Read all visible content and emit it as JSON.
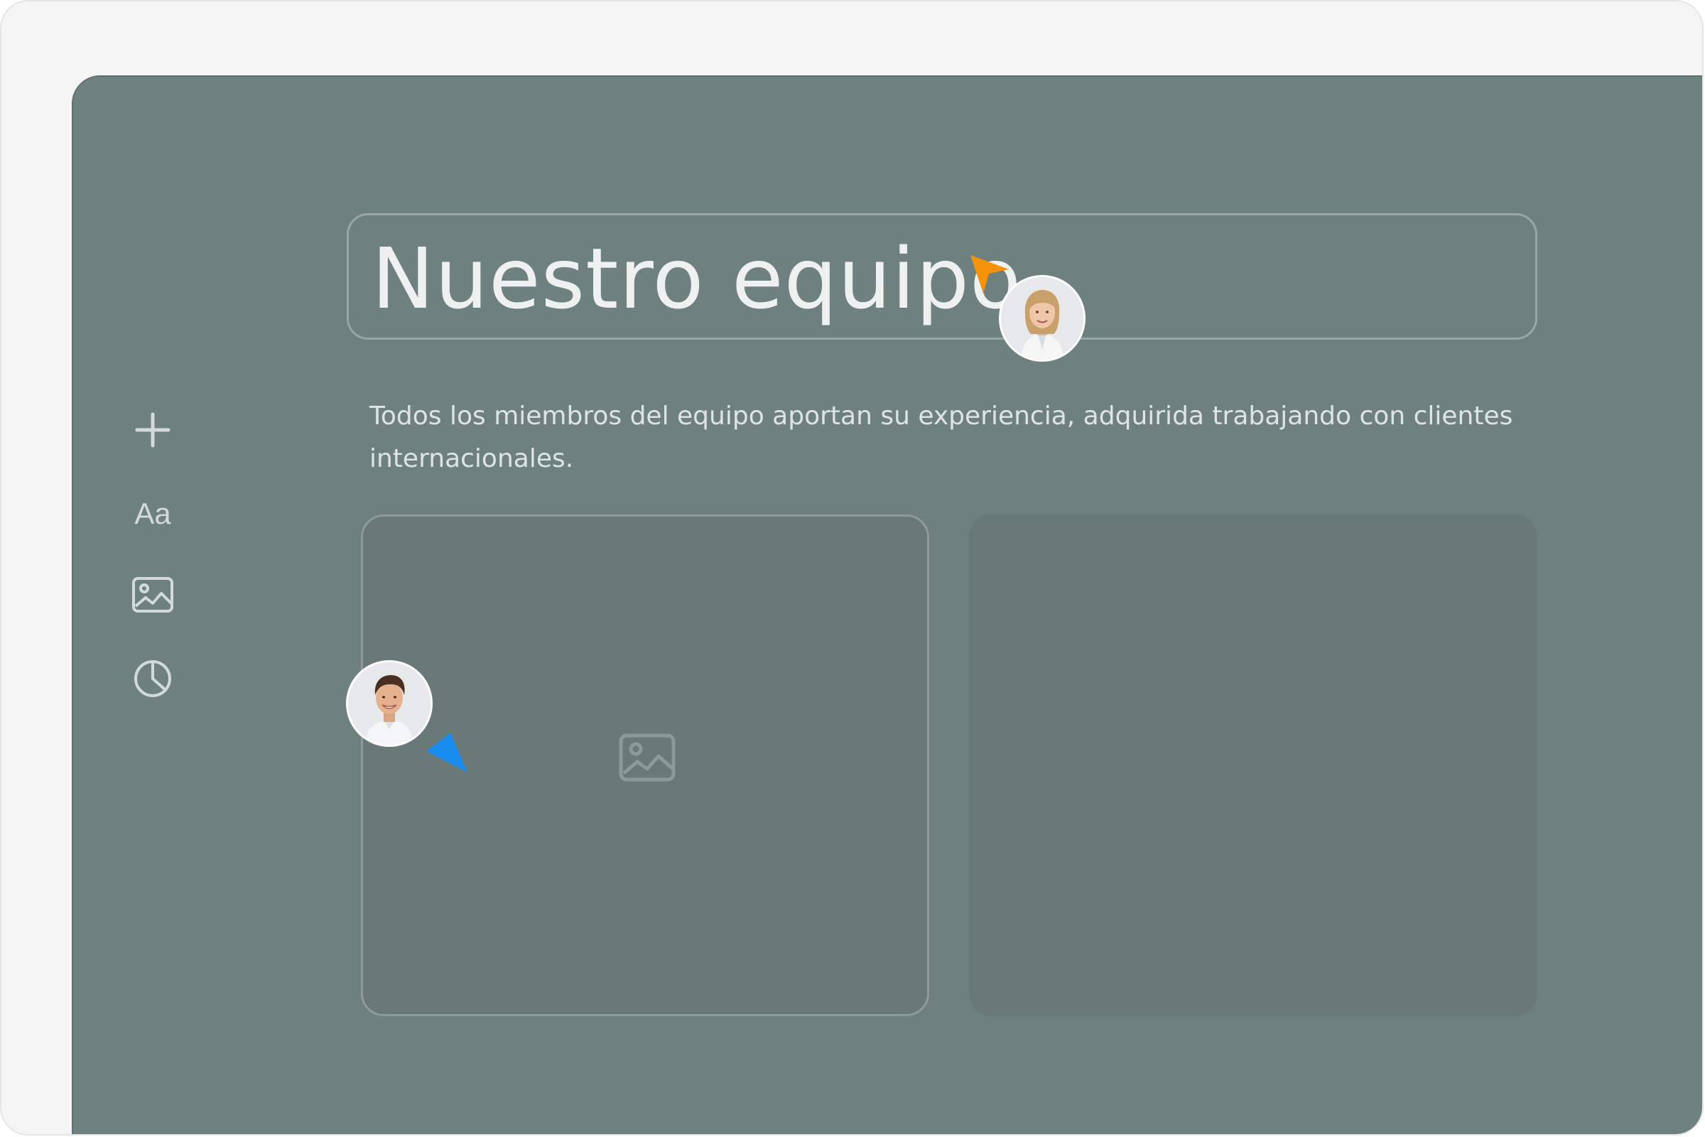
{
  "toolbar": {
    "items": [
      {
        "name": "add",
        "icon": "plus-icon"
      },
      {
        "name": "text",
        "label": "Aa"
      },
      {
        "name": "image",
        "icon": "image-icon"
      },
      {
        "name": "chart",
        "icon": "pie-chart-icon"
      }
    ]
  },
  "slide": {
    "title": "Nuestro equipo",
    "description": "Todos los miembros del equipo aportan su experiencia, adquirida trabajando con clientes internacionales."
  },
  "cards": {
    "left": {
      "placeholder_icon": "image-icon"
    },
    "right": {}
  },
  "collaborators": [
    {
      "name": "collaborator-woman",
      "cursor_color": "#f5930c"
    },
    {
      "name": "collaborator-man",
      "cursor_color": "#1a8cf0"
    }
  ],
  "colors": {
    "canvas": "#6f817f",
    "card": "#687977",
    "frame": "#f5f5f5",
    "orange_cursor": "#f5930c",
    "blue_cursor": "#1a8cf0"
  }
}
